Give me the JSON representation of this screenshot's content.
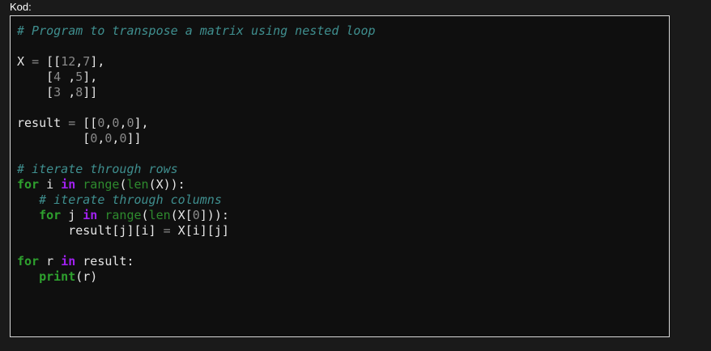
{
  "field_label": "Kod:",
  "code_lines": [
    [
      {
        "t": "comment",
        "v": "# Program to transpose a matrix using nested loop"
      }
    ],
    [],
    [
      {
        "t": "text",
        "v": "X "
      },
      {
        "t": "op",
        "v": "="
      },
      {
        "t": "text",
        "v": " [["
      },
      {
        "t": "number",
        "v": "12"
      },
      {
        "t": "text",
        "v": ","
      },
      {
        "t": "number",
        "v": "7"
      },
      {
        "t": "text",
        "v": "],"
      }
    ],
    [
      {
        "t": "text",
        "v": "    ["
      },
      {
        "t": "number",
        "v": "4"
      },
      {
        "t": "text",
        "v": " ,"
      },
      {
        "t": "number",
        "v": "5"
      },
      {
        "t": "text",
        "v": "],"
      }
    ],
    [
      {
        "t": "text",
        "v": "    ["
      },
      {
        "t": "number",
        "v": "3"
      },
      {
        "t": "text",
        "v": " ,"
      },
      {
        "t": "number",
        "v": "8"
      },
      {
        "t": "text",
        "v": "]]"
      }
    ],
    [],
    [
      {
        "t": "text",
        "v": "result "
      },
      {
        "t": "op",
        "v": "="
      },
      {
        "t": "text",
        "v": " [["
      },
      {
        "t": "number",
        "v": "0"
      },
      {
        "t": "text",
        "v": ","
      },
      {
        "t": "number",
        "v": "0"
      },
      {
        "t": "text",
        "v": ","
      },
      {
        "t": "number",
        "v": "0"
      },
      {
        "t": "text",
        "v": "],"
      }
    ],
    [
      {
        "t": "text",
        "v": "         ["
      },
      {
        "t": "number",
        "v": "0"
      },
      {
        "t": "text",
        "v": ","
      },
      {
        "t": "number",
        "v": "0"
      },
      {
        "t": "text",
        "v": ","
      },
      {
        "t": "number",
        "v": "0"
      },
      {
        "t": "text",
        "v": "]]"
      }
    ],
    [],
    [
      {
        "t": "comment",
        "v": "# iterate through rows"
      }
    ],
    [
      {
        "t": "keyword",
        "v": "for"
      },
      {
        "t": "text",
        "v": " i "
      },
      {
        "t": "operator",
        "v": "in"
      },
      {
        "t": "text",
        "v": " "
      },
      {
        "t": "builtin",
        "v": "range"
      },
      {
        "t": "text",
        "v": "("
      },
      {
        "t": "builtin",
        "v": "len"
      },
      {
        "t": "text",
        "v": "(X)):"
      }
    ],
    [
      {
        "t": "text",
        "v": "   "
      },
      {
        "t": "comment",
        "v": "# iterate through columns"
      }
    ],
    [
      {
        "t": "text",
        "v": "   "
      },
      {
        "t": "keyword",
        "v": "for"
      },
      {
        "t": "text",
        "v": " j "
      },
      {
        "t": "operator",
        "v": "in"
      },
      {
        "t": "text",
        "v": " "
      },
      {
        "t": "builtin",
        "v": "range"
      },
      {
        "t": "text",
        "v": "("
      },
      {
        "t": "builtin",
        "v": "len"
      },
      {
        "t": "text",
        "v": "(X["
      },
      {
        "t": "number",
        "v": "0"
      },
      {
        "t": "text",
        "v": "])):"
      }
    ],
    [
      {
        "t": "text",
        "v": "       result[j][i] "
      },
      {
        "t": "op",
        "v": "="
      },
      {
        "t": "text",
        "v": " X[i][j]"
      }
    ],
    [],
    [
      {
        "t": "keyword",
        "v": "for"
      },
      {
        "t": "text",
        "v": " r "
      },
      {
        "t": "operator",
        "v": "in"
      },
      {
        "t": "text",
        "v": " result:"
      }
    ],
    [
      {
        "t": "text",
        "v": "   "
      },
      {
        "t": "keyword",
        "v": "print"
      },
      {
        "t": "text",
        "v": "(r)"
      }
    ]
  ],
  "colors": {
    "comment": "#3f8f8f",
    "keyword": "#2ea02e",
    "operator": "#a020f0",
    "builtin": "#2e8b2e",
    "number": "#8a8a8a",
    "text": "#e6e6e6",
    "background": "#0f0f0f",
    "border": "#d8d8d8"
  }
}
